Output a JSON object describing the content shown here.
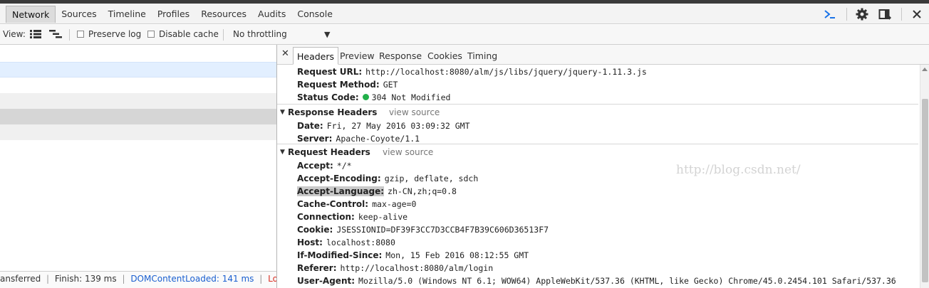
{
  "main_tabs": [
    "Network",
    "Sources",
    "Timeline",
    "Profiles",
    "Resources",
    "Audits",
    "Console"
  ],
  "toolbar": {
    "view_label": "View:",
    "preserve_log": "Preserve log",
    "disable_cache": "Disable cache",
    "throttling": "No throttling"
  },
  "status": {
    "transferred": "ansferred",
    "finish": "Finish: 139 ms",
    "dcl": "DOMContentLoaded: 141 ms",
    "load": "Loa..."
  },
  "detail_tabs": [
    "Headers",
    "Preview",
    "Response",
    "Cookies",
    "Timing"
  ],
  "general": [
    {
      "key": "Request URL:",
      "value": "http://localhost:8080/alm/js/libs/jquery/jquery-1.11.3.js"
    },
    {
      "key": "Request Method:",
      "value": "GET"
    },
    {
      "key": "Status Code:",
      "value": "304 Not Modified"
    }
  ],
  "response_headers": {
    "title": "Response Headers",
    "view_source": "view source",
    "items": [
      {
        "key": "Date:",
        "value": "Fri, 27 May 2016 03:09:32 GMT"
      },
      {
        "key": "Server:",
        "value": "Apache-Coyote/1.1"
      }
    ]
  },
  "request_headers": {
    "title": "Request Headers",
    "view_source": "view source",
    "items": [
      {
        "key": "Accept:",
        "value": "*/*"
      },
      {
        "key": "Accept-Encoding:",
        "value": "gzip, deflate, sdch"
      },
      {
        "key": "Accept-Language:",
        "value": "zh-CN,zh;q=0.8"
      },
      {
        "key": "Cache-Control:",
        "value": "max-age=0"
      },
      {
        "key": "Connection:",
        "value": "keep-alive"
      },
      {
        "key": "Cookie:",
        "value": "JSESSIONID=DF39F3CC7D3CCB4F7B39C606D36513F7"
      },
      {
        "key": "Host:",
        "value": "localhost:8080"
      },
      {
        "key": "If-Modified-Since:",
        "value": "Mon, 15 Feb 2016 08:12:55 GMT"
      },
      {
        "key": "Referer:",
        "value": "http://localhost:8080/alm/login"
      },
      {
        "key": "User-Agent:",
        "value": "Mozilla/5.0 (Windows NT 6.1; WOW64) AppleWebKit/537.36 (KHTML, like Gecko) Chrome/45.0.2454.101 Safari/537.36"
      }
    ]
  },
  "watermark": "http://blog.csdn.net/",
  "icons": [
    "console-prompt-icon",
    "gear-icon",
    "dock-icon",
    "close-icon",
    "list-view-icon",
    "waterfall-view-icon",
    "dropdown-arrow-icon"
  ],
  "colors": {
    "accent": "#1a73e8",
    "status_ok": "#21b04a",
    "load_red": "#d93025",
    "dcl_blue": "#1a5fd0"
  }
}
